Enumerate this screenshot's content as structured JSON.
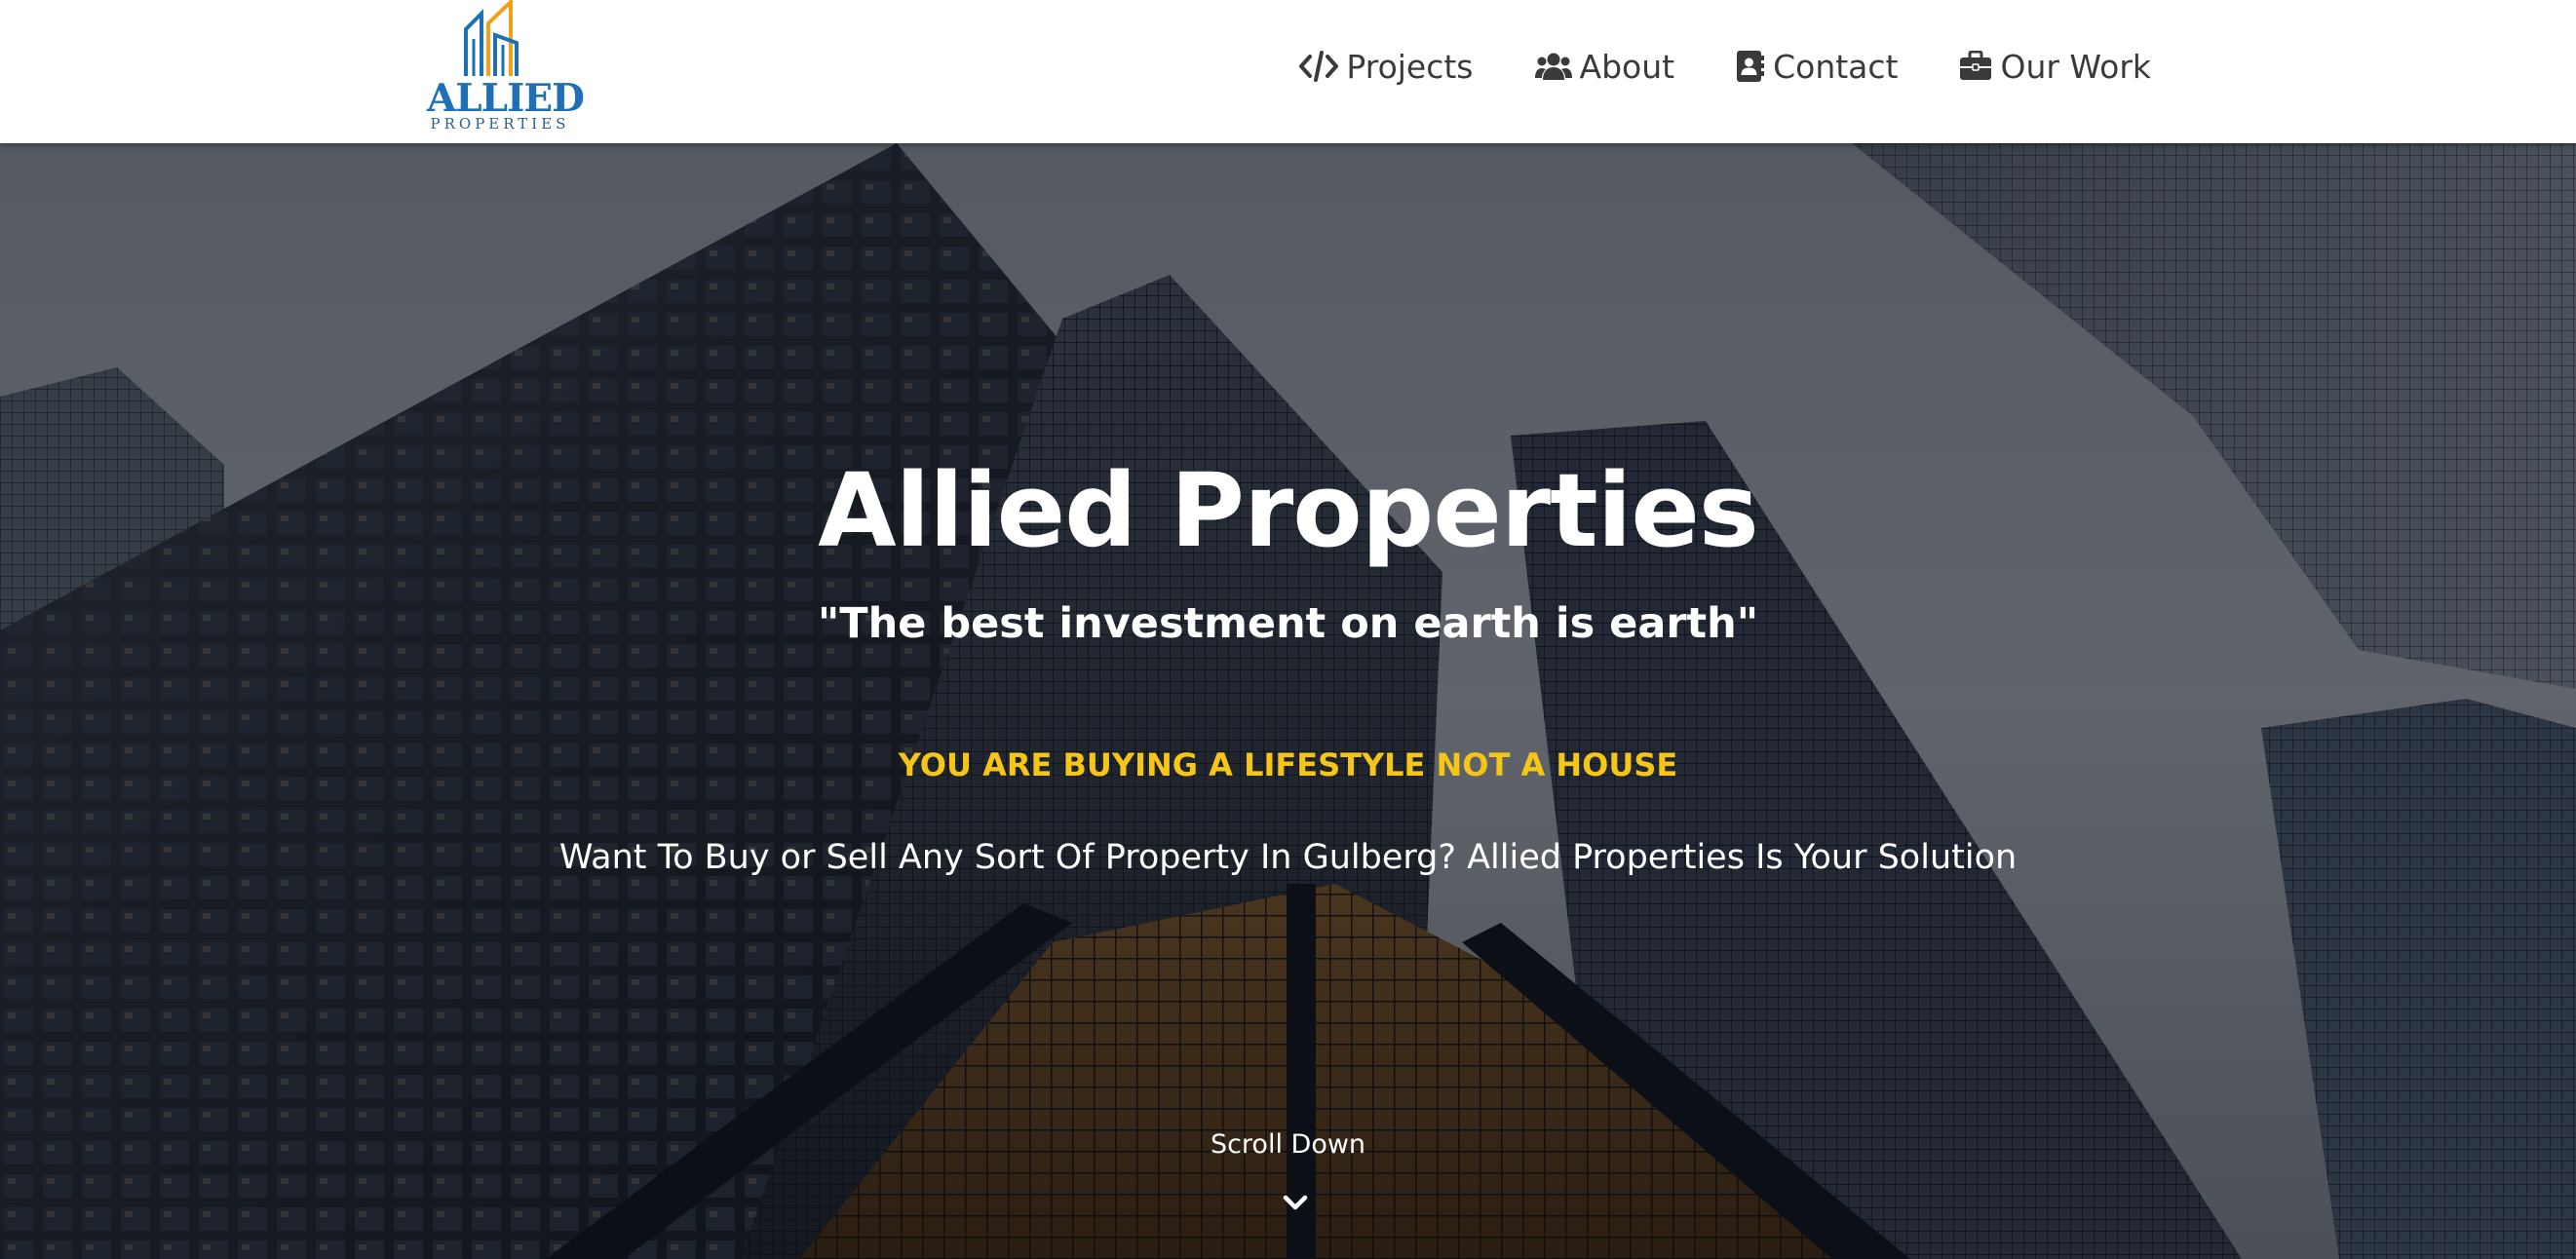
{
  "brand": {
    "name": "ALLIED",
    "subname": "PROPERTIES",
    "primary_color": "#1e6fb5",
    "accent_color": "#f2a01a"
  },
  "nav": {
    "items": [
      {
        "label": "Projects",
        "icon": "code-icon"
      },
      {
        "label": "About",
        "icon": "users-icon"
      },
      {
        "label": "Contact",
        "icon": "address-book-icon"
      },
      {
        "label": "Our Work",
        "icon": "briefcase-icon"
      }
    ]
  },
  "hero": {
    "title": "Allied Properties",
    "quote": "\"The best investment on earth is earth\"",
    "tagline": "YOU ARE BUYING A LIFESTYLE NOT A HOUSE",
    "description": "Want To Buy or Sell Any Sort Of Property In Gulberg? Allied Properties Is Your Solution",
    "scroll_label": "Scroll Down",
    "scroll_icon": "chevron-down-icon",
    "tagline_color": "#f5c518"
  }
}
